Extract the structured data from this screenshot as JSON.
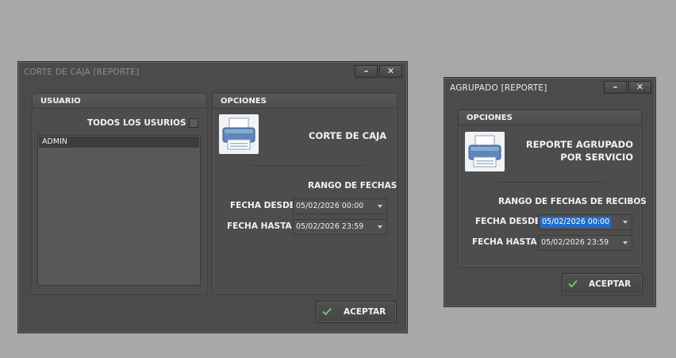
{
  "window_left": {
    "title": "CORTE DE CAJA [REPORTE]",
    "minimize_label": "–",
    "close_label": "✕",
    "usuario_group": {
      "title": "USUARIO",
      "all_users_label": "TODOS LOS USURIOS",
      "users": [
        "ADMIN"
      ]
    },
    "opciones_group": {
      "title": "OPCIONES",
      "report_title": "CORTE DE CAJA",
      "range_label": "RANGO DE FECHAS",
      "fecha_desde_label": "FECHA DESDE",
      "fecha_desde_value": "05/02/2026 00:00",
      "fecha_hasta_label": "FECHA HASTA",
      "fecha_hasta_value": "05/02/2026 23:59"
    },
    "accept_label": "ACEPTAR"
  },
  "window_right": {
    "title": "AGRUPADO [REPORTE]",
    "minimize_label": "–",
    "close_label": "✕",
    "opciones_group": {
      "title": "OPCIONES",
      "report_title_line1": "REPORTE AGRUPADO",
      "report_title_line2": "POR SERVICIO",
      "range_label": "RANGO DE FECHAS DE RECIBOS",
      "fecha_desde_label": "FECHA DESDE",
      "fecha_desde_value": "05/02/2026 00:00",
      "fecha_hasta_label": "FECHA HASTA",
      "fecha_hasta_value": "05/02/2026 23:59"
    },
    "accept_label": "ACEPTAR"
  },
  "colors": {
    "desktop": "#a8a8a8",
    "window": "#4b4b4b",
    "selection": "#1e6ec8",
    "accept_check": "#7fb77a"
  },
  "icons": [
    "printer-icon",
    "check-icon",
    "minimize-icon",
    "close-icon",
    "dropdown-arrow-icon"
  ]
}
